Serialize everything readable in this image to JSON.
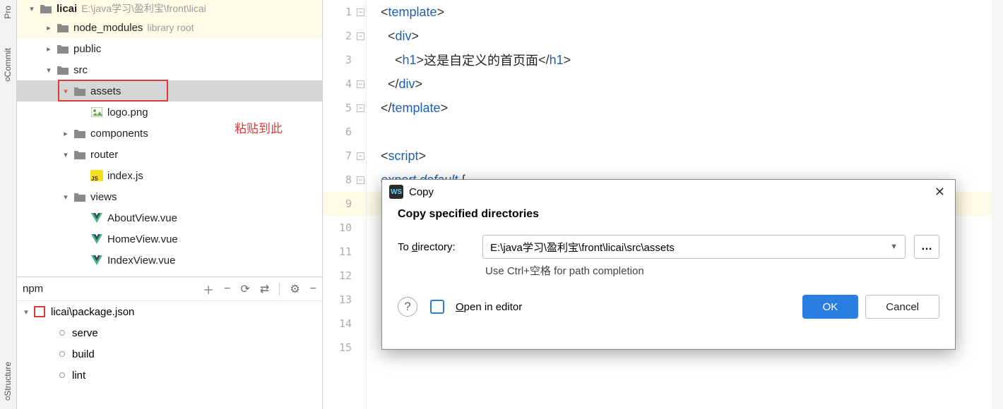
{
  "sidebar_tabs": {
    "pro": "Pro",
    "commit": "Commit",
    "structure": "Structure"
  },
  "tree": {
    "root": {
      "name": "licai",
      "path": "E:\\java学习\\盈利宝\\front\\licai"
    },
    "node_modules": {
      "name": "node_modules",
      "tag": "library root"
    },
    "public": "public",
    "src": "src",
    "assets": "assets",
    "logo": "logo.png",
    "components": "components",
    "router": "router",
    "index_js": "index.js",
    "views": "views",
    "about": "AboutView.vue",
    "home": "HomeView.vue",
    "index_view": "IndexView.vue"
  },
  "annotation": "粘贴到此",
  "npm": {
    "title": "npm",
    "pkg": "licai\\package.json",
    "scripts": [
      "serve",
      "build",
      "lint"
    ]
  },
  "editor": {
    "lines": [
      {
        "n": 1,
        "parts": [
          [
            "p",
            "<"
          ],
          [
            "t",
            "template"
          ],
          [
            "p",
            ">"
          ]
        ]
      },
      {
        "n": 2,
        "parts": [
          [
            "p",
            "  <"
          ],
          [
            "t",
            "div"
          ],
          [
            "p",
            ">"
          ]
        ]
      },
      {
        "n": 3,
        "parts": [
          [
            "p",
            "    <"
          ],
          [
            "t",
            "h1"
          ],
          [
            "p",
            ">"
          ],
          [
            "tx",
            "这是自定义的首页面"
          ],
          [
            "p",
            "</"
          ],
          [
            "t",
            "h1"
          ],
          [
            "p",
            ">"
          ]
        ]
      },
      {
        "n": 4,
        "parts": [
          [
            "p",
            "  </"
          ],
          [
            "t",
            "div"
          ],
          [
            "p",
            ">"
          ]
        ]
      },
      {
        "n": 5,
        "parts": [
          [
            "p",
            "</"
          ],
          [
            "t",
            "template"
          ],
          [
            "p",
            ">"
          ]
        ]
      },
      {
        "n": 6,
        "parts": []
      },
      {
        "n": 7,
        "parts": [
          [
            "p",
            "<"
          ],
          [
            "t",
            "script"
          ],
          [
            "p",
            ">"
          ]
        ]
      },
      {
        "n": 8,
        "parts": [
          [
            "k",
            "export default "
          ],
          [
            "p",
            "{"
          ]
        ]
      },
      {
        "n": 9,
        "parts": [],
        "hl": true
      },
      {
        "n": 10,
        "parts": []
      },
      {
        "n": 11,
        "parts": []
      },
      {
        "n": 12,
        "parts": []
      },
      {
        "n": 13,
        "parts": []
      },
      {
        "n": 14,
        "parts": []
      },
      {
        "n": 15,
        "parts": []
      }
    ]
  },
  "dialog": {
    "title": "Copy",
    "heading": "Copy specified directories",
    "to_label_pre": "To ",
    "to_label_u": "d",
    "to_label_post": "irectory:",
    "path": "E:\\java学习\\盈利宝\\front\\licai\\src\\assets",
    "hint": "Use Ctrl+空格 for path completion",
    "open_pre": "",
    "open_u": "O",
    "open_post": "pen in editor",
    "ok": "OK",
    "cancel": "Cancel"
  }
}
